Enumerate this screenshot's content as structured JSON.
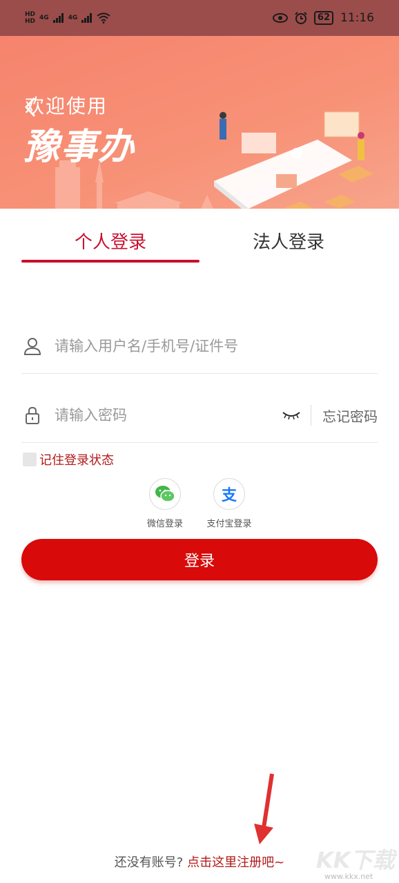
{
  "status_bar": {
    "sim1": "HD",
    "sim2": "HD",
    "net1": "4G",
    "net2": "4G",
    "battery": "62",
    "time": "11:16"
  },
  "banner": {
    "welcome": "欢迎使用",
    "brand": "豫事办"
  },
  "tabs": {
    "personal": "个人登录",
    "legal": "法人登录",
    "active": "personal"
  },
  "form": {
    "username_placeholder": "请输入用户名/手机号/证件号",
    "password_placeholder": "请输入密码",
    "forgot_password": "忘记密码",
    "remember_label": "记住登录状态"
  },
  "third_party": {
    "wechat_label": "微信登录",
    "alipay_label": "支付宝登录",
    "alipay_glyph": "支"
  },
  "login_button": "登录",
  "register": {
    "prompt": "还没有账号?",
    "link": "点击这里注册吧~"
  },
  "watermark": {
    "logo": "KK下载",
    "url": "www.kkx.net"
  },
  "colors": {
    "accent": "#c8102e",
    "button": "#d80a0a",
    "banner": "#f6836d"
  }
}
